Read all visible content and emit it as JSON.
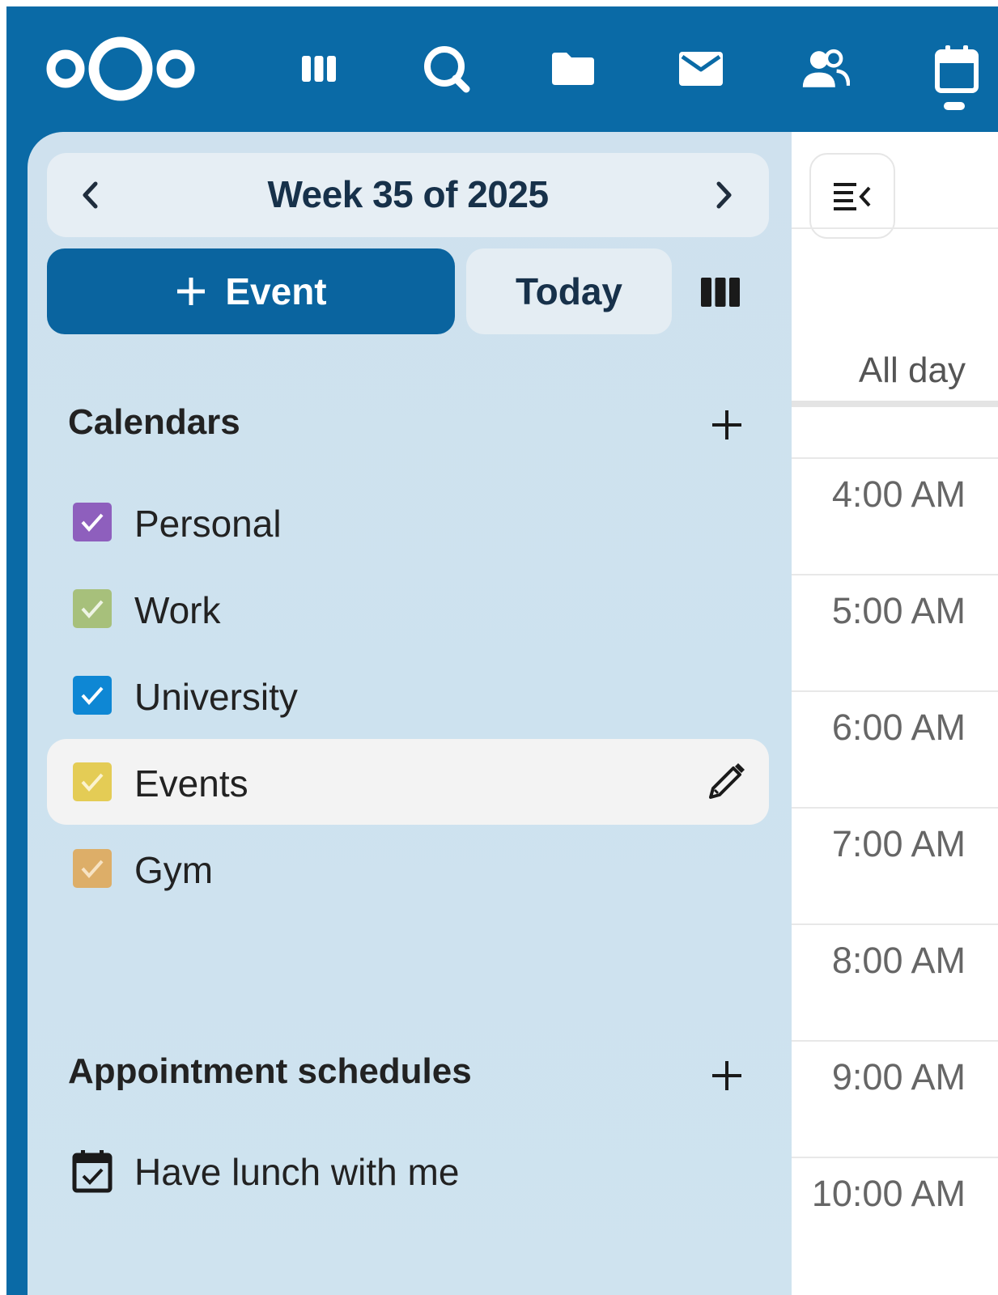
{
  "header": {
    "logo": "nextcloud-logo",
    "apps": [
      {
        "name": "dashboard-icon"
      },
      {
        "name": "search-icon"
      },
      {
        "name": "files-icon"
      },
      {
        "name": "mail-icon"
      },
      {
        "name": "contacts-icon"
      },
      {
        "name": "calendar-icon",
        "active": true
      }
    ]
  },
  "navigation": {
    "date_picker": {
      "title": "Week 35 of 2025"
    },
    "new_event_label": "Event",
    "today_label": "Today",
    "calendars_title": "Calendars",
    "calendars": [
      {
        "label": "Personal",
        "color": "#8e5fbd",
        "checked": true
      },
      {
        "label": "Work",
        "color": "#a7c07b",
        "checked": true
      },
      {
        "label": "University",
        "color": "#0e87d4",
        "checked": true
      },
      {
        "label": "Events",
        "color": "#e4cc55",
        "checked": true,
        "hovered": true
      },
      {
        "label": "Gym",
        "color": "#ddae68",
        "checked": true
      }
    ],
    "appointments_title": "Appointment schedules",
    "appointments": [
      {
        "label": "Have lunch with me"
      }
    ]
  },
  "grid": {
    "all_day_label": "All day",
    "times": [
      "4:00 AM",
      "5:00 AM",
      "6:00 AM",
      "7:00 AM",
      "8:00 AM",
      "9:00 AM",
      "10:00 AM"
    ]
  },
  "colors": {
    "header_bg": "#0a6aa6",
    "primary_button": "#0a649f",
    "nav_bg": "#cfe1ee"
  }
}
